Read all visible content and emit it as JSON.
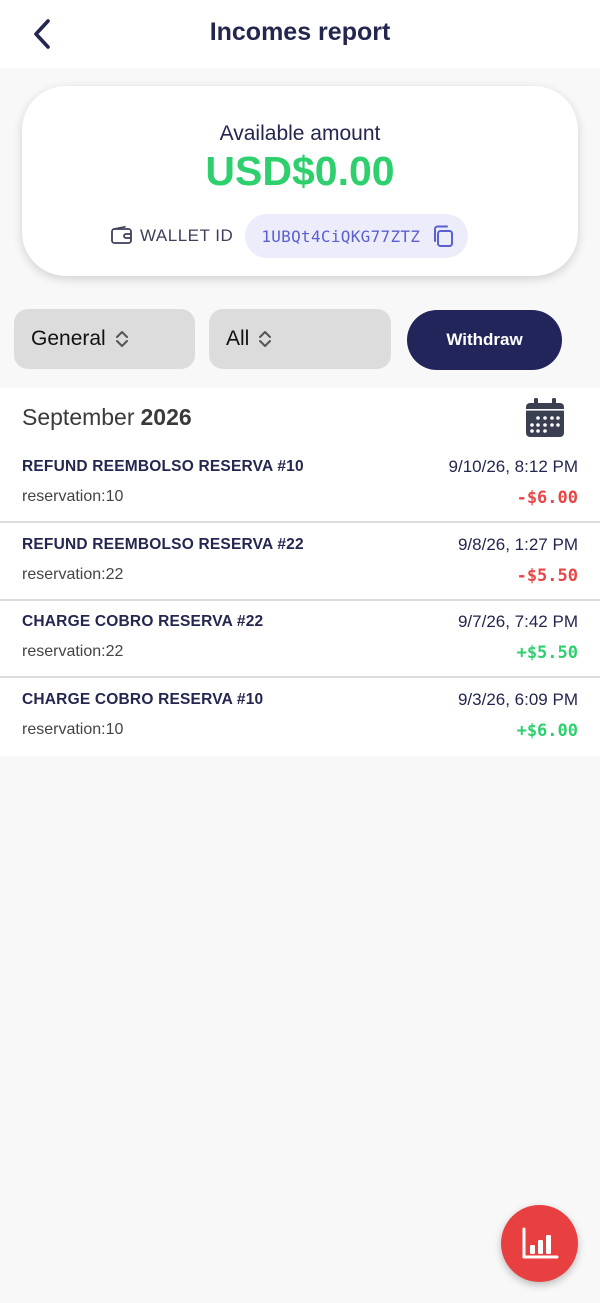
{
  "header": {
    "title": "Incomes report",
    "back_icon": "chevron-left-icon"
  },
  "balance": {
    "label": "Available amount",
    "amount": "USD$0.00",
    "amount_color": "#2ed06e",
    "wallet_label": "WALLET ID",
    "wallet_id": "1UBQt4CiQKG77ZTZ",
    "wallet_icon": "wallet-icon",
    "copy_icon": "copy-icon"
  },
  "filters": {
    "type_selected": "General",
    "scope_selected": "All",
    "withdraw_label": "Withdraw"
  },
  "list": {
    "month": "September",
    "year": "2026",
    "calendar_icon": "calendar-icon",
    "transactions": [
      {
        "title": "REFUND REEMBOLSO RESERVA #10",
        "reference": "reservation:10",
        "date": "9/10/26, 8:12 PM",
        "amount": "-$6.00",
        "sign": "negative"
      },
      {
        "title": "REFUND REEMBOLSO RESERVA #22",
        "reference": "reservation:22",
        "date": "9/8/26, 1:27 PM",
        "amount": "-$5.50",
        "sign": "negative"
      },
      {
        "title": "CHARGE COBRO RESERVA #22",
        "reference": "reservation:22",
        "date": "9/7/26, 7:42 PM",
        "amount": "+$5.50",
        "sign": "positive"
      },
      {
        "title": "CHARGE COBRO RESERVA #10",
        "reference": "reservation:10",
        "date": "9/3/26, 6:09 PM",
        "amount": "+$6.00",
        "sign": "positive"
      }
    ]
  },
  "fab": {
    "icon": "bar-chart-icon",
    "color": "#e83f40"
  },
  "colors": {
    "primary_navy": "#22255a",
    "positive": "#2ed06e",
    "negative": "#e84646",
    "wallet_id_text": "#5a5fd1"
  }
}
